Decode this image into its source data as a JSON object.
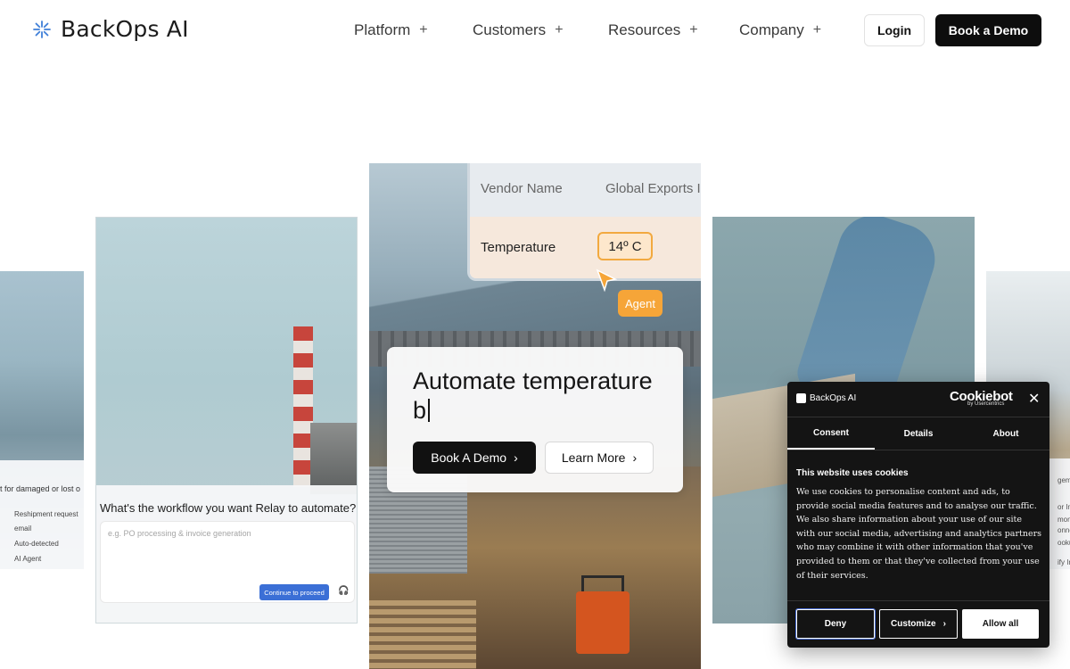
{
  "brand": {
    "name": "BackOps AI"
  },
  "nav": {
    "items": [
      {
        "label": "Platform",
        "toggle": "+"
      },
      {
        "label": "Customers",
        "toggle": "+"
      },
      {
        "label": "Resources",
        "toggle": "+"
      },
      {
        "label": "Company",
        "toggle": "+"
      }
    ],
    "login_label": "Login",
    "demo_label": "Book a Demo"
  },
  "far_left_card": {
    "partial_text": "t for damaged or lost o",
    "tags": [
      "Reshipment request",
      "email",
      "Auto-detected",
      "AI Agent"
    ]
  },
  "left_card": {
    "question": "What's the workflow you want Relay to automate?",
    "placeholder": "e.g. PO processing & invoice generation",
    "continue_label": "Continue to proceed",
    "headset_icon": "🎧"
  },
  "center_card": {
    "vendor_label": "Vendor Name",
    "vendor_value": "Global Exports I",
    "temp_label": "Temperature",
    "temp_value": "14º C",
    "agent_label": "Agent",
    "headline": "Automate temperature b",
    "demo_button": "Book A Demo",
    "learn_button": "Learn More",
    "chevron": "›"
  },
  "far_right_card": {
    "fragments": [
      "gemen",
      "or Inbo",
      "monito",
      "onnect",
      "ookusT",
      "ify Inte"
    ]
  },
  "cookie": {
    "brand": "BackOps AI",
    "provider": "Cookiebot",
    "provider_by": "by Usercentrics",
    "close_glyph": "✕",
    "tabs": [
      "Consent",
      "Details",
      "About"
    ],
    "heading": "This website uses cookies",
    "body": "We use cookies to personalise content and ads, to provide social media features and to analyse our traffic. We also share information about your use of our site with our social media, advertising and analytics partners who may combine it with other information that you've provided to them or that they've collected from your use of their services.",
    "deny_label": "Deny",
    "customize_label": "Customize",
    "customize_chevron": "›",
    "allow_label": "Allow all"
  },
  "colors": {
    "accent_dark": "#0d0d0d",
    "agent_orange": "#f6a538",
    "continue_blue": "#3b6fd6",
    "logo_blue": "#3f7fd8"
  }
}
